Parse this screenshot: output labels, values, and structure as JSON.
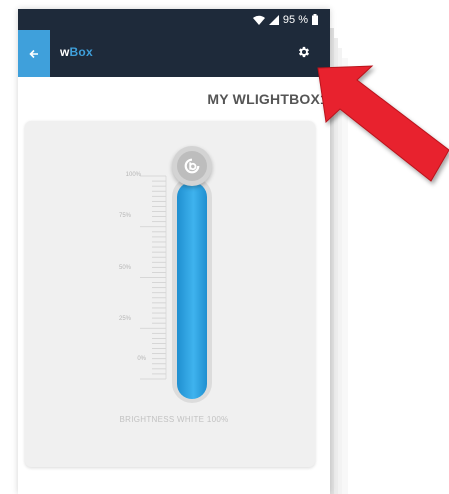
{
  "status_bar": {
    "battery_text": "95 %",
    "icons": [
      "wifi-icon",
      "signal-icon",
      "battery-icon"
    ]
  },
  "app_bar": {
    "title_prefix": "w",
    "title_suffix": "Box",
    "back_icon": "arrow-left-icon",
    "settings_icon": "gear-icon",
    "accent_color": "#3fa0db",
    "background_color": "#1e2a3a"
  },
  "device": {
    "name": "MY WLIGHTBOX1"
  },
  "brightness_control": {
    "scale_labels": [
      "100%",
      "75%",
      "50%",
      "25%",
      "0%"
    ],
    "value_percent": 100,
    "caption": "BRIGHTNESS WHITE 100%",
    "fill_color": "#2aa2e3",
    "knob_icon": "blebox-logo-icon"
  },
  "annotation": {
    "color": "#e8232f",
    "target": "settings-button"
  }
}
